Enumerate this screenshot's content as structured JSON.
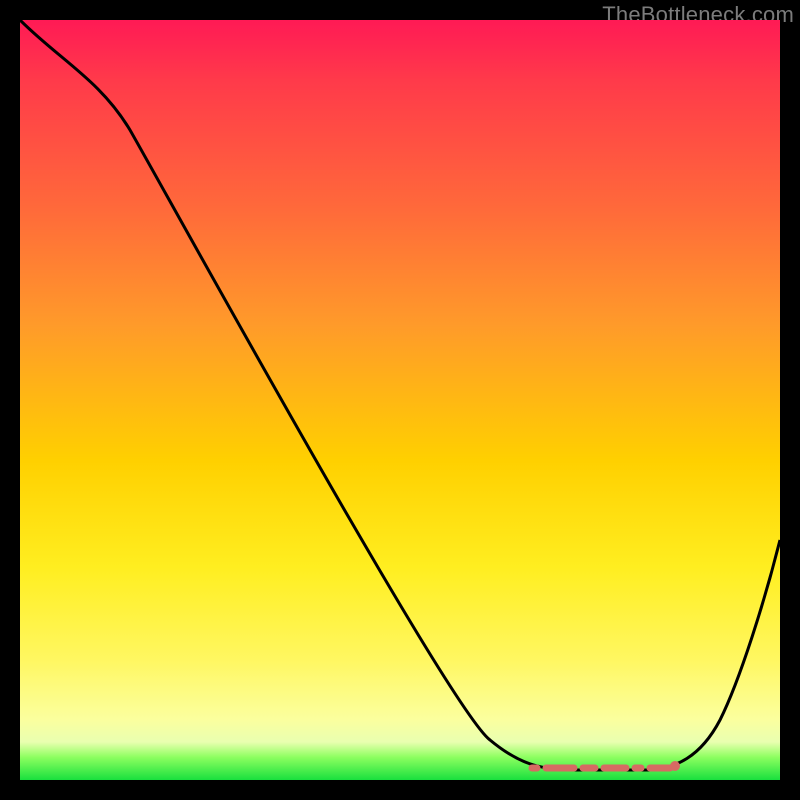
{
  "watermark": "TheBottleneck.com",
  "colors": {
    "background": "#000000",
    "gradient_top": "#ff1a55",
    "gradient_mid": "#ffd000",
    "gradient_bottom": "#19e03e",
    "curve_stroke": "#000000",
    "flat_segment_stroke": "#d66a63"
  },
  "chart_data": {
    "type": "line",
    "title": "",
    "xlabel": "",
    "ylabel": "",
    "xlim": [
      0,
      100
    ],
    "ylim": [
      0,
      100
    ],
    "grid": false,
    "legend": false,
    "series": [
      {
        "name": "bottleneck-curve",
        "x": [
          0,
          3,
          8,
          14,
          20,
          26,
          32,
          38,
          44,
          50,
          56,
          60,
          63,
          66,
          70,
          74,
          78,
          82,
          86,
          90,
          94,
          98,
          100
        ],
        "y": [
          100,
          98,
          95,
          89,
          82,
          74,
          65,
          56,
          47,
          38,
          28,
          20,
          14,
          9,
          5,
          3,
          2,
          2,
          3,
          6,
          14,
          28,
          38
        ]
      }
    ],
    "annotations": [
      {
        "name": "flat-bottom-dashed",
        "style": "dashed",
        "color": "#d66a63",
        "x_range": [
          68,
          86
        ],
        "y": 2
      }
    ],
    "note": "Axis values are estimated on a 0-100 normalized scale; no tick labels or explicit units are visible in the source image."
  }
}
